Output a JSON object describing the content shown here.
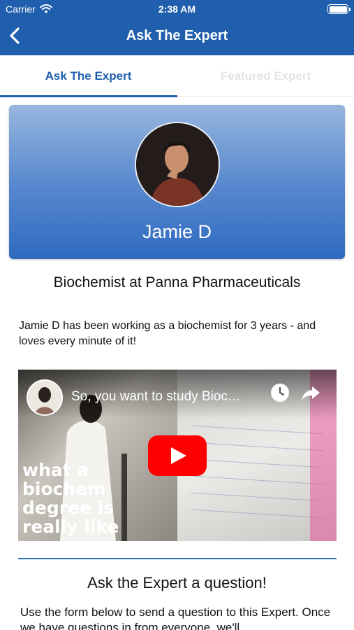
{
  "status_bar": {
    "carrier": "Carrier",
    "time": "2:38 AM"
  },
  "nav": {
    "title": "Ask The Expert",
    "back_icon": "chevron-left-icon"
  },
  "tabs": [
    {
      "label": "Ask The Expert",
      "active": true
    },
    {
      "label": "Featured Expert",
      "active": false
    }
  ],
  "profile": {
    "name": "Jamie D",
    "role": "Biochemist at Panna Pharmaceuticals"
  },
  "bio": "Jamie D has been working as a biochemist for 3 years - and loves every minute of it!",
  "video": {
    "title": "So, you want to study Bioc…",
    "overlay_text": "what a biochem degree is really like",
    "icons": [
      "watch-later-icon",
      "share-icon",
      "play-icon"
    ]
  },
  "question": {
    "heading": "Ask the Expert a question!",
    "body": "Use the form below to send a question to this Expert. Once we have questions in from everyone, we'll"
  },
  "colors": {
    "brand_blue": "#1f5fae",
    "inactive_tab": "#e4e4e4",
    "play_red": "#ff0000"
  }
}
